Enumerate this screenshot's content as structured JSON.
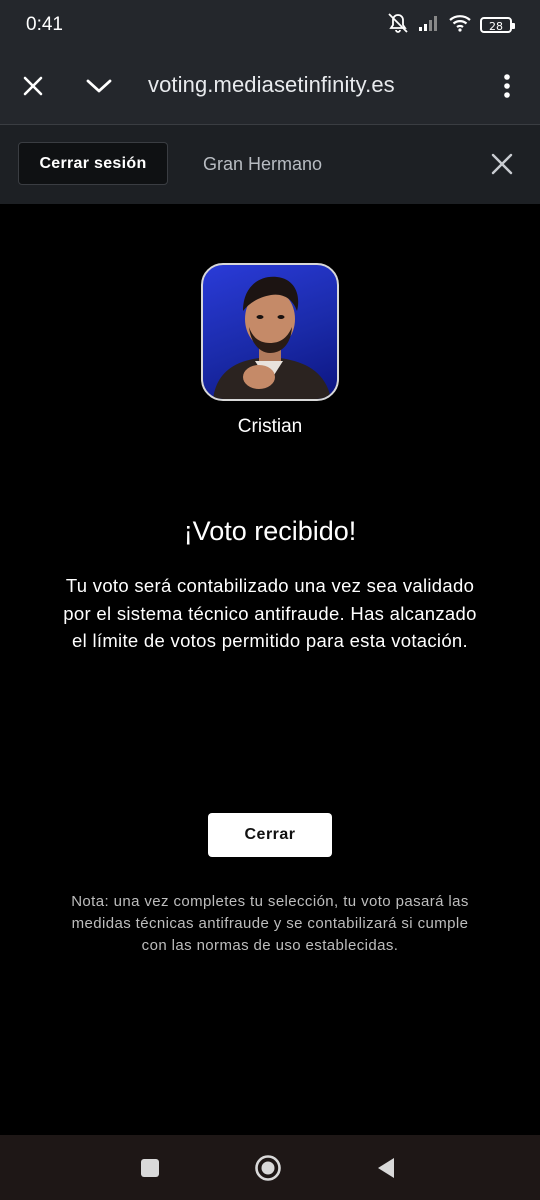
{
  "status_bar": {
    "time": "0:41",
    "battery": "28",
    "icons": [
      "mute-vibrate-icon",
      "signal-icon",
      "wifi-icon",
      "battery-icon"
    ]
  },
  "browser": {
    "url": "voting.mediasetinfinity.es",
    "icons": [
      "close-icon",
      "chevron-down-icon",
      "more-vert-icon"
    ]
  },
  "site_header": {
    "logout_label": "Cerrar sesión",
    "show_title": "Gran Hermano"
  },
  "vote": {
    "candidate_name": "Cristian",
    "heading": "¡Voto recibido!",
    "message": "Tu voto será contabilizado una vez sea validado por el sistema técnico antifraude. Has alcanzado el límite de votos permitido para esta votación.",
    "close_label": "Cerrar",
    "note": "Nota: una vez completes tu selección, tu voto pasará las medidas técnicas antifraude y se contabilizará si cumple con las normas de uso establecidas."
  },
  "nav_bar": {
    "icons": [
      "recents-icon",
      "home-icon",
      "back-icon"
    ]
  },
  "colors": {
    "background": "#000000",
    "toolbar": "#24272c",
    "header": "#1d2024",
    "avatar_bg": "#1f2fc8"
  }
}
